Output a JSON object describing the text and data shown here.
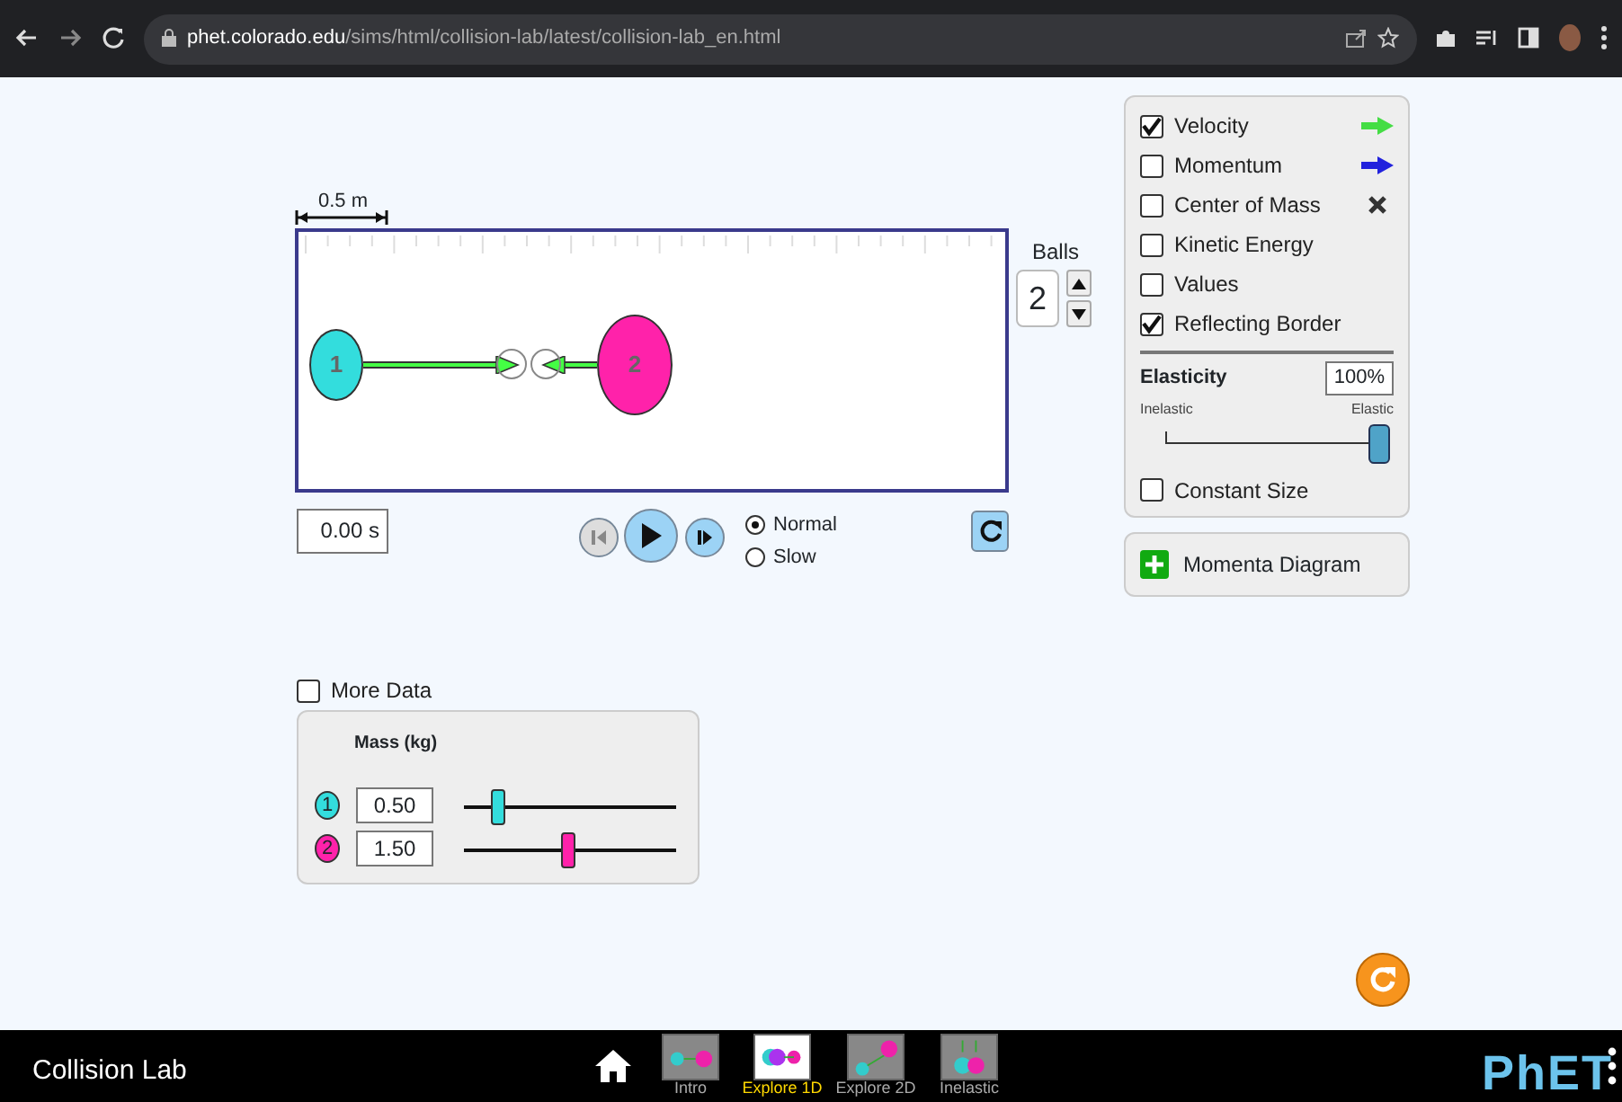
{
  "browser": {
    "url_host": "phet.colorado.edu",
    "url_path": "/sims/html/collision-lab/latest/collision-lab_en.html"
  },
  "play_area": {
    "scale_label": "0.5 m",
    "balls": [
      {
        "label": "1",
        "color": "#33dddd"
      },
      {
        "label": "2",
        "color": "#ff22aa"
      }
    ],
    "reflecting_border": true
  },
  "balls_spinner": {
    "label": "Balls",
    "value": "2"
  },
  "time": "0.00 s",
  "speed_options": [
    {
      "label": "Normal",
      "selected": true
    },
    {
      "label": "Slow",
      "selected": false
    }
  ],
  "options": [
    {
      "label": "Velocity",
      "checked": true,
      "kind": "velocity"
    },
    {
      "label": "Momentum",
      "checked": false,
      "kind": "momentum"
    },
    {
      "label": "Center of Mass",
      "checked": false,
      "kind": "center"
    },
    {
      "label": "Kinetic Energy",
      "checked": false,
      "kind": "plain"
    },
    {
      "label": "Values",
      "checked": false,
      "kind": "plain"
    },
    {
      "label": "Reflecting Border",
      "checked": true,
      "kind": "plain"
    }
  ],
  "elasticity": {
    "title": "Elasticity",
    "value": "100%",
    "min_label": "Inelastic",
    "max_label": "Elastic",
    "level": 1.0
  },
  "constant_size": {
    "label": "Constant Size",
    "checked": false
  },
  "momenta_diagram": {
    "label": "Momenta Diagram"
  },
  "more_data": {
    "label": "More Data",
    "checked": false
  },
  "mass_panel": {
    "title": "Mass (kg)",
    "rows": [
      {
        "ball": "1",
        "color": "#33dddd",
        "value": "0.50",
        "level": 0.14
      },
      {
        "ball": "2",
        "color": "#ff22aa",
        "value": "1.50",
        "level": 0.49
      }
    ]
  },
  "nav": {
    "title": "Collision Lab",
    "screens": [
      {
        "label": "Intro",
        "selected": false
      },
      {
        "label": "Explore 1D",
        "selected": true
      },
      {
        "label": "Explore 2D",
        "selected": false
      },
      {
        "label": "Inelastic",
        "selected": false
      }
    ],
    "logo": "PhET"
  }
}
